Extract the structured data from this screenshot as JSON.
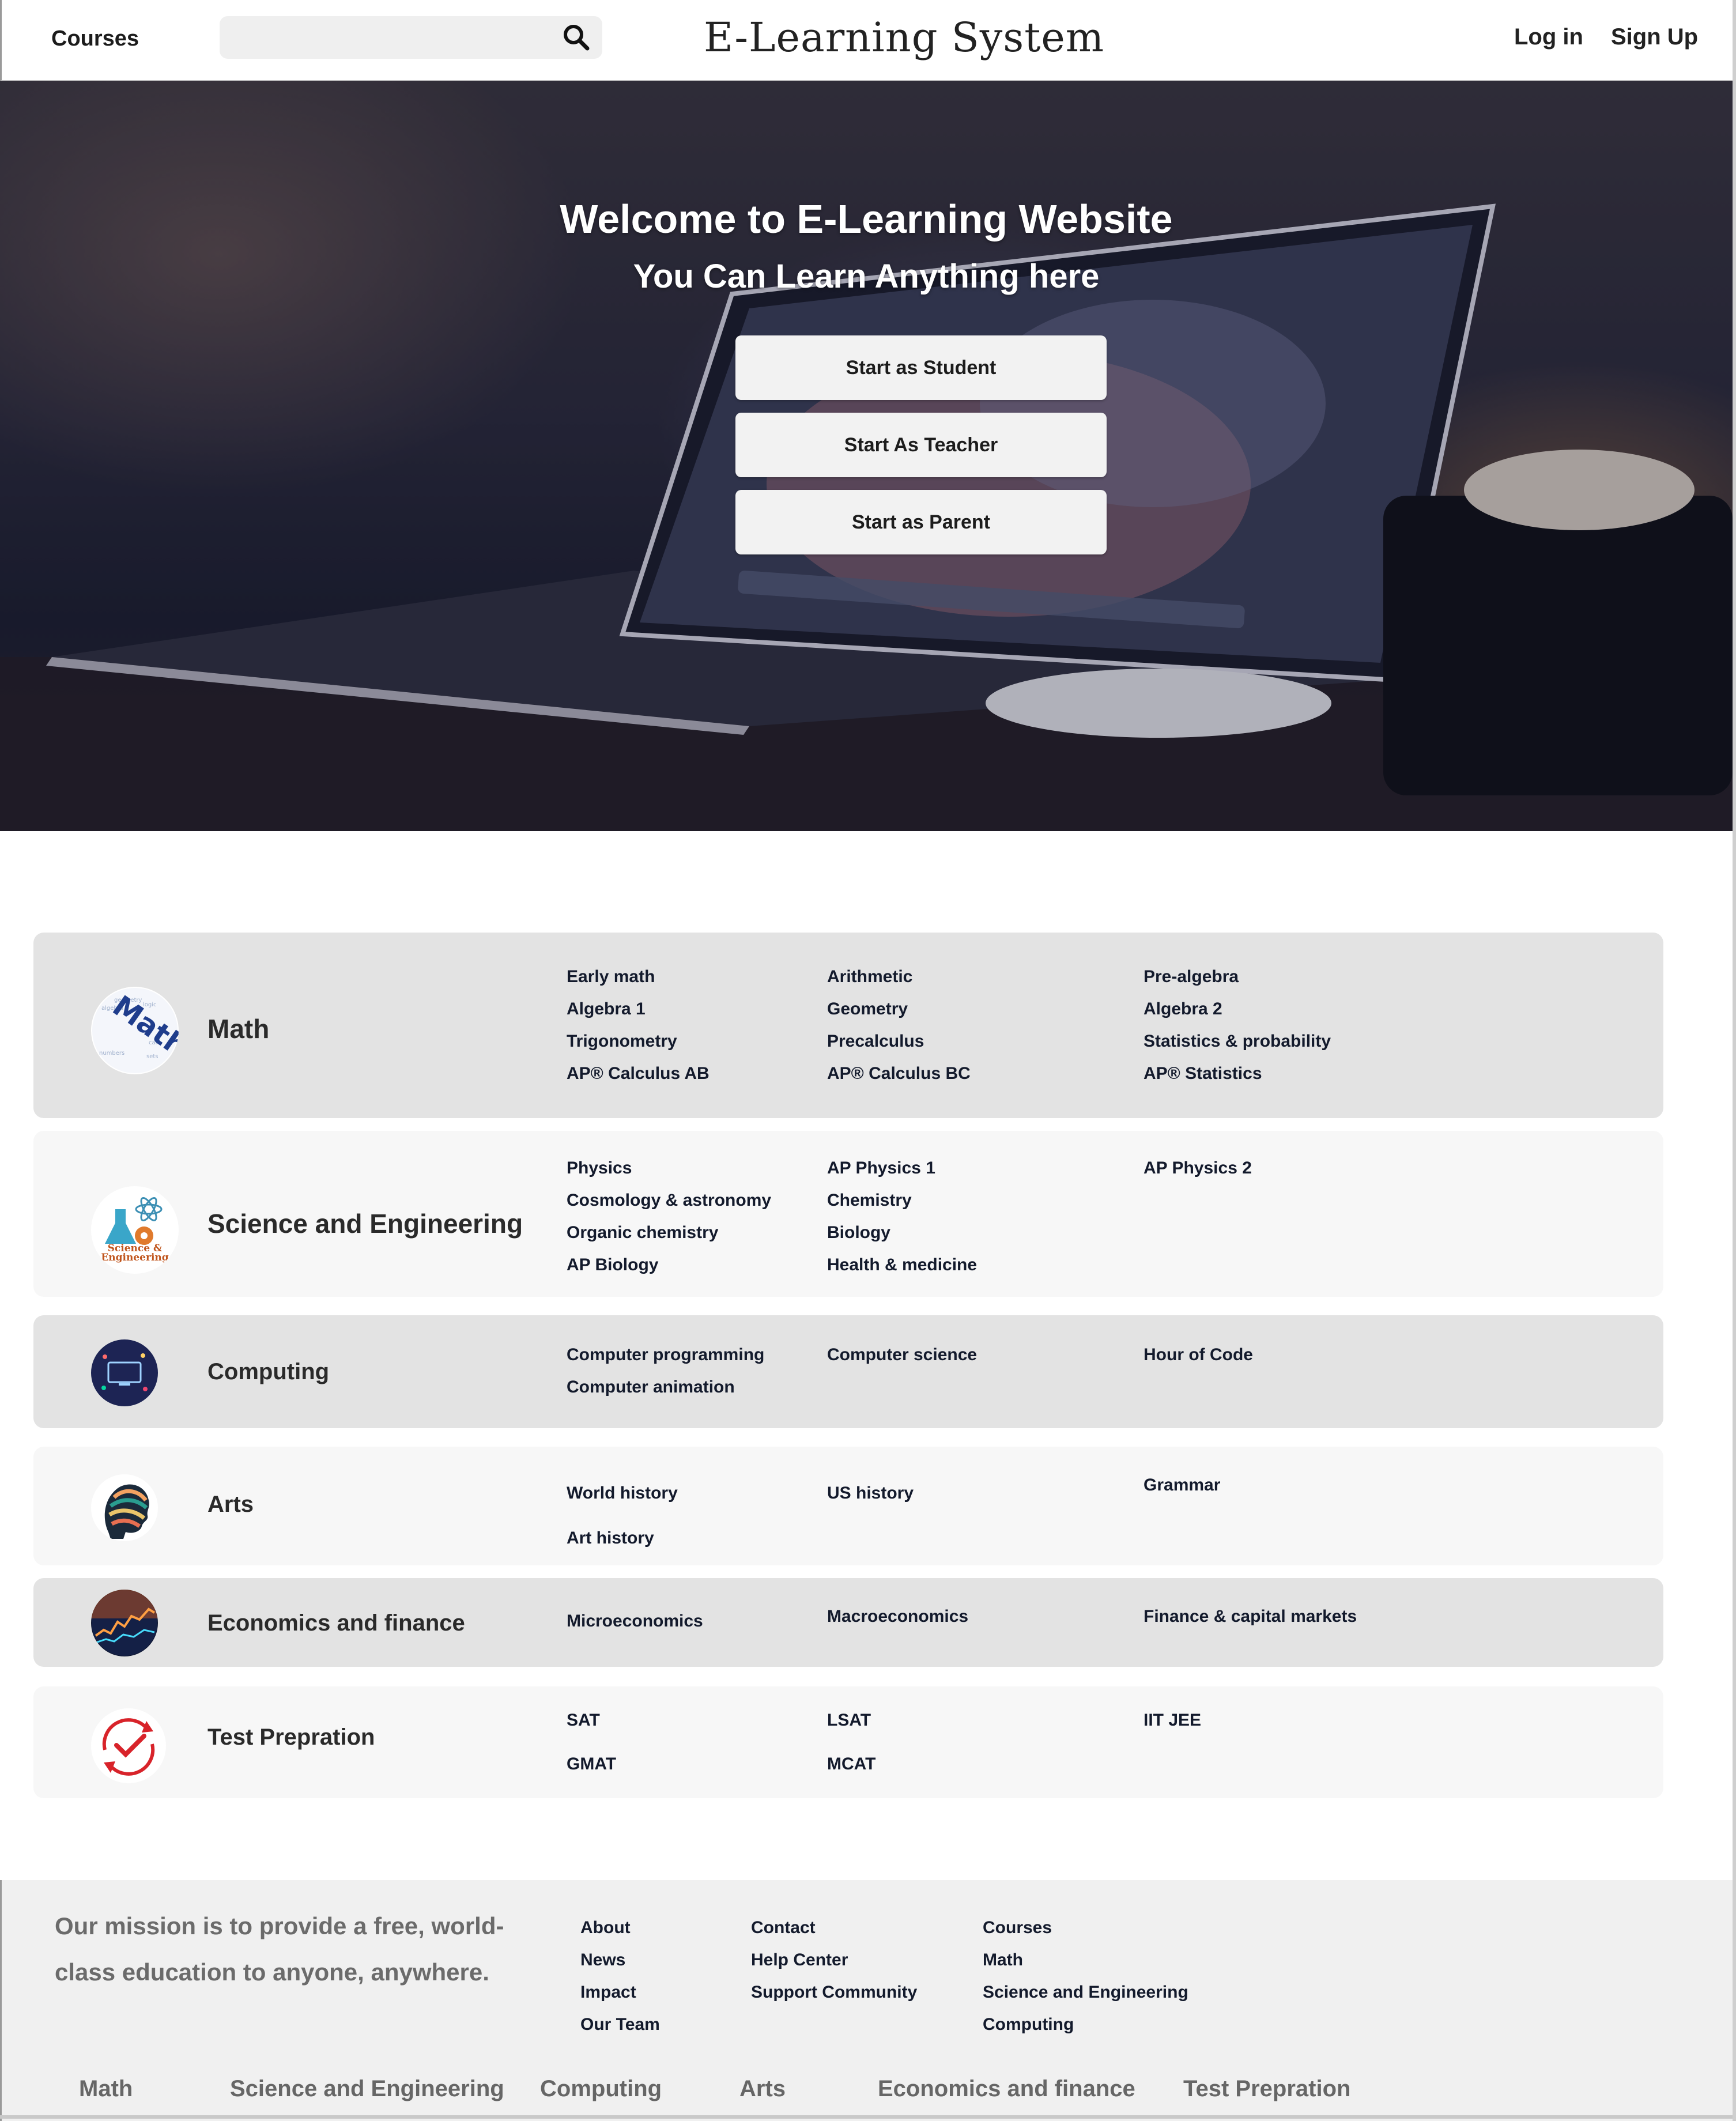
{
  "header": {
    "courses_label": "Courses",
    "search_placeholder": "",
    "site_title": "E-Learning System",
    "login_label": "Log in",
    "signup_label": "Sign Up"
  },
  "hero": {
    "title": "Welcome to E-Learning Website",
    "subtitle": "You Can Learn Anything here",
    "buttons": [
      "Start as Student",
      "Start As Teacher",
      "Start as Parent"
    ]
  },
  "categories": [
    {
      "name": "Math",
      "icon": "math-word-cloud-icon",
      "topics": [
        [
          "Early math",
          "Algebra 1",
          "Trigonometry",
          "AP® Calculus AB"
        ],
        [
          "Arithmetic",
          "Geometry",
          "Precalculus",
          "AP® Calculus BC"
        ],
        [
          "Pre-algebra",
          "Algebra 2",
          "Statistics & probability",
          "AP® Statistics"
        ]
      ]
    },
    {
      "name": "Science and Engineering",
      "icon": "science-flask-atom-icon",
      "icon_text": "Science & Engineering",
      "topics": [
        [
          "Physics",
          "Cosmology & astronomy",
          "Organic chemistry",
          "AP Biology"
        ],
        [
          "AP Physics 1",
          "Chemistry",
          "Biology",
          "Health & medicine"
        ],
        [
          "AP Physics 2"
        ]
      ]
    },
    {
      "name": "Computing",
      "icon": "computing-screen-icon",
      "topics": [
        [
          "Computer programming",
          "Computer animation"
        ],
        [
          "Computer science"
        ],
        [
          "Hour of Code"
        ]
      ]
    },
    {
      "name": "Arts",
      "icon": "colorful-head-profile-icon",
      "topics": [
        [
          "World history",
          "Art history"
        ],
        [
          "US history"
        ],
        [
          "Grammar"
        ]
      ]
    },
    {
      "name": "Economics  and finance",
      "icon": "stock-chart-icon",
      "topics": [
        [
          "Microeconomics"
        ],
        [
          "Macroeconomics"
        ],
        [
          "Finance & capital markets"
        ]
      ]
    },
    {
      "name": "Test Prepration",
      "icon": "checkmark-cycle-icon",
      "topics": [
        [
          "SAT",
          "GMAT"
        ],
        [
          "LSAT",
          "MCAT"
        ],
        [
          "IIT JEE"
        ]
      ]
    }
  ],
  "footer": {
    "mission": "Our mission is to provide a free, world-class education to anyone, anywhere.",
    "columns": [
      [
        "About",
        "News",
        "Impact",
        "Our Team"
      ],
      [
        "Contact",
        "Help Center",
        "Support Community"
      ],
      [
        "Courses",
        "Math",
        "Science and Engineering",
        "Computing"
      ]
    ],
    "category_links": [
      "Math",
      "Science and Engineering",
      "Computing",
      "Arts",
      "Economics  and finance",
      "Test Prepration"
    ]
  },
  "colors": {
    "row_dark": "#e3e3e3",
    "row_light": "#f7f7f7",
    "footer_bg": "#f0f0f0",
    "topic_text": "#131a2c"
  }
}
